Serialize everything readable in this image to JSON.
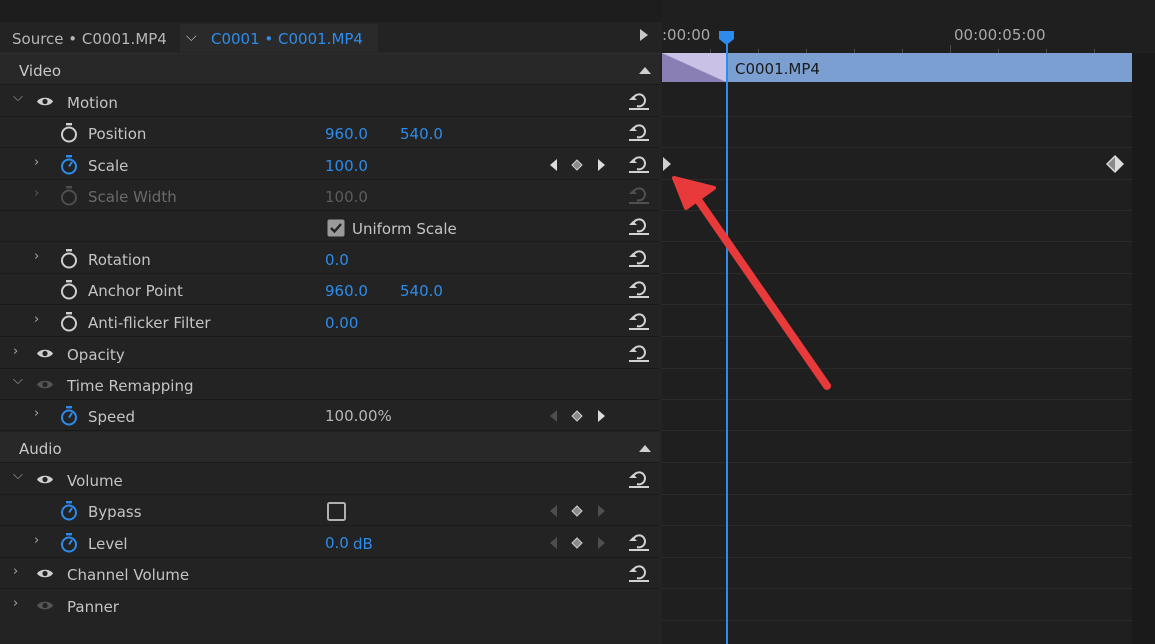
{
  "tabs": {
    "source": "Source • C0001.MP4",
    "clip": "C0001 • C0001.MP4"
  },
  "sections": {
    "video": "Video",
    "audio": "Audio"
  },
  "effects": {
    "motion": "Motion",
    "opacity": "Opacity",
    "time_remapping": "Time Remapping",
    "volume": "Volume",
    "channel_volume": "Channel Volume",
    "panner": "Panner"
  },
  "params": {
    "position": {
      "label": "Position",
      "x": "960.0",
      "y": "540.0"
    },
    "scale": {
      "label": "Scale",
      "value": "100.0"
    },
    "scale_width": {
      "label": "Scale Width",
      "value": "100.0"
    },
    "uniform_scale": {
      "label": "Uniform Scale",
      "checked": true
    },
    "rotation": {
      "label": "Rotation",
      "value": "0.0"
    },
    "anchor_point": {
      "label": "Anchor Point",
      "x": "960.0",
      "y": "540.0"
    },
    "anti_flicker": {
      "label": "Anti-flicker Filter",
      "value": "0.00"
    },
    "speed": {
      "label": "Speed",
      "value": "100.00%"
    },
    "bypass": {
      "label": "Bypass",
      "checked": false
    },
    "level": {
      "label": "Level",
      "value": "0.0",
      "unit": "dB"
    }
  },
  "timeline": {
    "tc_start": ":00:00",
    "tc_5s": "00:00:05:00",
    "clip_name": "C0001.MP4"
  },
  "colors": {
    "accent": "#2d8ceb",
    "clip": "#7b9fd1",
    "arrow": "#e8393b"
  }
}
